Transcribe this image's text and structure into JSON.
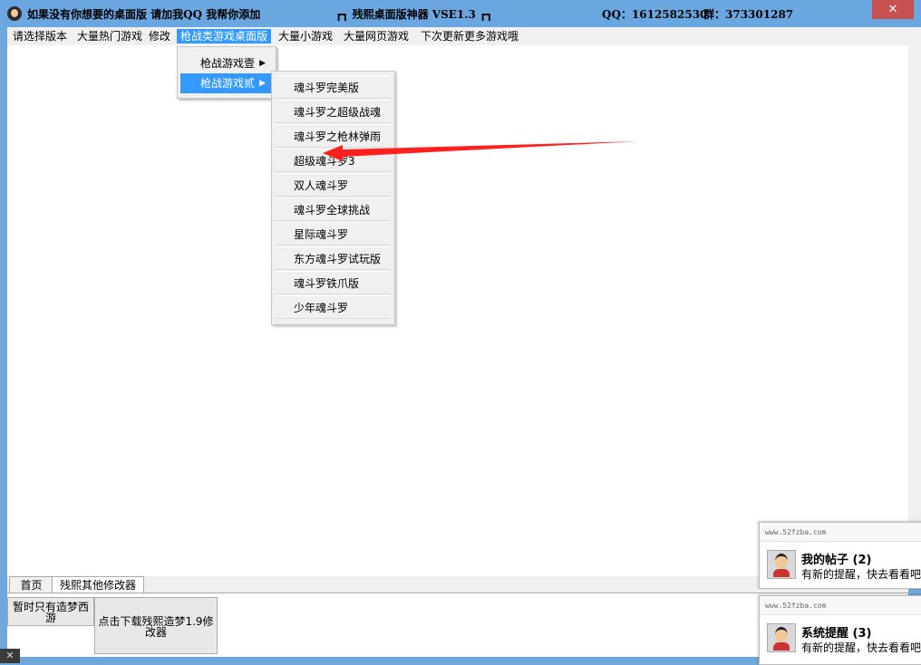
{
  "window": {
    "title_left": "如果没有你想要的桌面版 请加我QQ 我帮你添加",
    "title_center": "┏┓ 残熙桌面版神器 VSE1.3 ┏┓",
    "qq": "QQ：1612582530",
    "group": "群：373301287",
    "close_label": "✕"
  },
  "menubar": {
    "items": [
      "请选择版本",
      "大量热门游戏",
      "修改",
      "枪战类游戏桌面版",
      "大量小游戏",
      "大量网页游戏",
      "下次更新更多游戏哦"
    ]
  },
  "dropdown": {
    "items": [
      {
        "label": "枪战游戏壹",
        "arrow": "▶"
      },
      {
        "label": "枪战游戏贰",
        "arrow": "▶"
      }
    ]
  },
  "submenu": {
    "items": [
      "魂斗罗完美版",
      "魂斗罗之超级战魂",
      "魂斗罗之枪林弹雨",
      "超级魂斗罗3",
      "双人魂斗罗",
      "魂斗罗全球挑战",
      "星际魂斗罗",
      "东方魂斗罗试玩版",
      "魂斗罗铁爪版",
      "少年魂斗罗"
    ]
  },
  "annotation": {
    "arrow_color": "#ff2020"
  },
  "bottom": {
    "tabs": [
      "首页",
      "残熙其他修改器"
    ],
    "buttons": [
      "暂时只有造梦西游",
      "点击下载残熙造梦1.9修改器"
    ]
  },
  "taskbar": {
    "close_glyph": "✕"
  },
  "notifications": [
    {
      "site": "www.52fzba.com",
      "title": "我的帖子",
      "count": "(2)",
      "body": "有新的提醒，快去看看吧"
    },
    {
      "site": "www.52fzba.com",
      "title": "系统提醒",
      "count": "(3)",
      "body": "有新的提醒，快去看看吧"
    }
  ]
}
